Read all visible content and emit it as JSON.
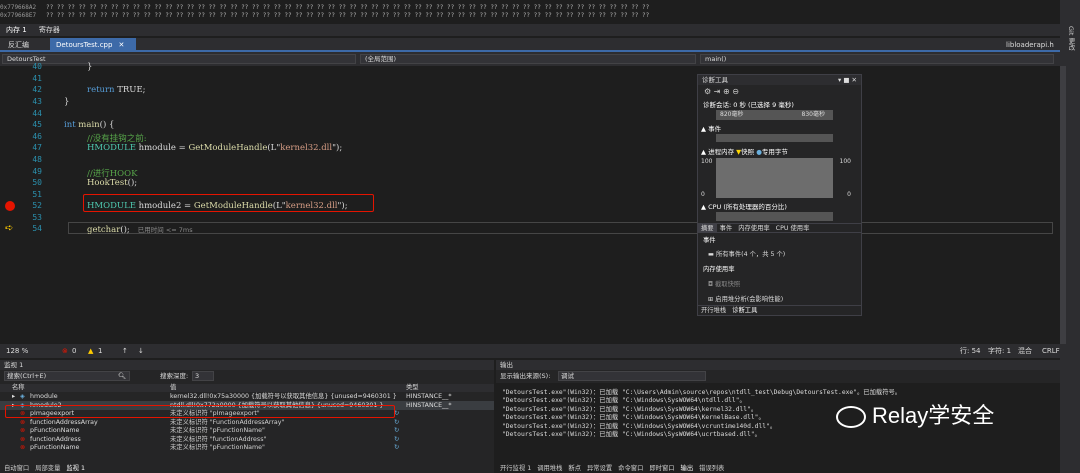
{
  "memory": {
    "rows": [
      {
        "addr": "0x779668A2",
        "bytes": "?? ?? ?? ?? ?? ?? ?? ?? ?? ?? ?? ?? ?? ?? ?? ?? ?? ?? ?? ?? ?? ?? ?? ?? ?? ?? ?? ?? ?? ?? ?? ?? ?? ?? ?? ?? ?? ?? ?? ?? ?? ?? ?? ?? ?? ?? ?? ?? ?? ?? ?? ?? ?? ?? ?? ??"
      },
      {
        "addr": "0x779668E7",
        "bytes": "?? ?? ?? ?? ?? ?? ?? ?? ?? ?? ?? ?? ?? ?? ?? ?? ?? ?? ?? ?? ?? ?? ?? ?? ?? ?? ?? ?? ?? ?? ?? ?? ?? ?? ?? ?? ?? ?? ?? ?? ?? ?? ?? ?? ?? ?? ?? ?? ?? ?? ?? ?? ?? ?? ?? ??"
      }
    ],
    "tabs": [
      "内存 1",
      "寄存器"
    ]
  },
  "tabs": {
    "disasm": "反汇编",
    "active": "DetoursTest.cpp",
    "right": "libloaderapi.h"
  },
  "nav": {
    "project": "DetoursTest",
    "scope": "(全局范围)",
    "func": "main()"
  },
  "code": {
    "line_numbers": [
      "40",
      "41",
      "42",
      "43",
      "44",
      "45",
      "46",
      "47",
      "48",
      "49",
      "50",
      "51",
      "52",
      "53",
      "54"
    ],
    "l40": "}",
    "l42_kw": "return",
    "l42_rest": " TRUE;",
    "l43": "}",
    "l45_kw": "int",
    "l45_fn": " main",
    "l45_rest": "() {",
    "l46": "//没有挂钩之前:",
    "l47_ty": "HMODULE",
    "l47_var": " hmodule",
    "l47_eq": " = ",
    "l47_fn": "GetModuleHandle",
    "l47_open": "(L\"",
    "l47_str": "kernel32.dll",
    "l47_close": "\");",
    "l49": "//进行HOOK",
    "l50_fn": "HookTest",
    "l50_rest": "();",
    "l52_ty": "HMODULE",
    "l52_var": " hmodule2",
    "l52_eq": " = ",
    "l52_fn": "GetModuleHandle",
    "l52_open": "(L\"",
    "l52_str": "kernel32.dll",
    "l52_close": "\");",
    "l54_fn": "getchar",
    "l54_rest": "();",
    "l54_hint": "已用时间 <= 7ms"
  },
  "diag": {
    "title": "诊断工具",
    "session": "诊断会话: 0 秒 (已选择 9 毫秒)",
    "t1": "820毫秒",
    "t2": "830毫秒",
    "events": "▲ 事件",
    "process_memory": "▲ 进程内存",
    "snapshot": "快照",
    "private_bytes": "专用字节",
    "mem_max": "100",
    "mem_min": "0",
    "cpu": "▲ CPU (所有处理器的百分比)",
    "cpu_max": "100",
    "cpu_min": "0",
    "tabs": [
      "摘要",
      "事件",
      "内存使用率",
      "CPU 使用率"
    ],
    "ev_head": "事件",
    "ev_all": "所有事件(4 个，共 5 个)",
    "mem_head": "内存使用率",
    "take_snapshot": "截取快照",
    "heap_analysis": "启用堆分析(会影响性能)",
    "bottom_tabs": [
      "开行堆栈",
      "诊断工具"
    ]
  },
  "status": {
    "zoom": "128 %",
    "errors": "0",
    "warnings": "1",
    "line": "行: 54",
    "col": "字符: 1",
    "mode": "混合",
    "eol": "CRLF"
  },
  "watch": {
    "title": "监视 1",
    "search": "搜索(Ctrl+E)",
    "depth_label": "搜索深度:",
    "depth": "3",
    "cols": [
      "名称",
      "值",
      "类型"
    ],
    "rows": [
      {
        "name": "hmodule",
        "value": "kernel32.dll!0x75a30000 {加载符号以获取其他信息} {unused=9460301 }",
        "type": "HINSTANCE__*"
      },
      {
        "name": "hmodule2",
        "value": "ntdll.dll!0x772a0000 {加载符号以获取其他信息} {unused=9460301 }",
        "type": "HINSTANCE__*"
      },
      {
        "name": "pImageexport",
        "value": "未定义标识符 \"pImageexport\"",
        "type": ""
      },
      {
        "name": "functionAddressArray",
        "value": "未定义标识符 \"FunctionAddressArray\"",
        "type": ""
      },
      {
        "name": "pFunctionName",
        "value": "未定义标识符 \"pFunctionName\"",
        "type": ""
      },
      {
        "name": "functionAddress",
        "value": "未定义标识符 \"functionAddress\"",
        "type": ""
      },
      {
        "name": "pFunctionName",
        "value": "未定义标识符 \"pFunctionName\"",
        "type": ""
      }
    ],
    "bottom_tabs": [
      "自动窗口",
      "局部变量",
      "监视 1"
    ]
  },
  "output": {
    "title": "输出",
    "source_label": "显示输出来源(S):",
    "source": "调试",
    "lines": [
      "\"DetoursTest.exe\"(Win32)：已加载 \"C:\\Users\\Admin\\source\\repos\\ntdll_test\\Debug\\DetoursTest.exe\"。已加载符号。",
      "\"DetoursTest.exe\"(Win32)：已加载 \"C:\\Windows\\SysWOW64\\ntdll.dll\"。",
      "\"DetoursTest.exe\"(Win32)：已加载 \"C:\\Windows\\SysWOW64\\kernel32.dll\"。",
      "\"DetoursTest.exe\"(Win32)：已加载 \"C:\\Windows\\SysWOW64\\KernelBase.dll\"。",
      "\"DetoursTest.exe\"(Win32)：已加载 \"C:\\Windows\\SysWOW64\\vcruntime140d.dll\"。",
      "\"DetoursTest.exe\"(Win32)：已加载 \"C:\\Windows\\SysWOW64\\ucrtbased.dll\"。"
    ],
    "bottom_tabs": [
      "开行监视 1",
      "调用堆栈",
      "断点",
      "异常设置",
      "命令窗口",
      "即时窗口",
      "输出",
      "错误列表"
    ],
    "watermark": "Relay学安全"
  },
  "sidebar": {
    "label": "Git 更改"
  }
}
